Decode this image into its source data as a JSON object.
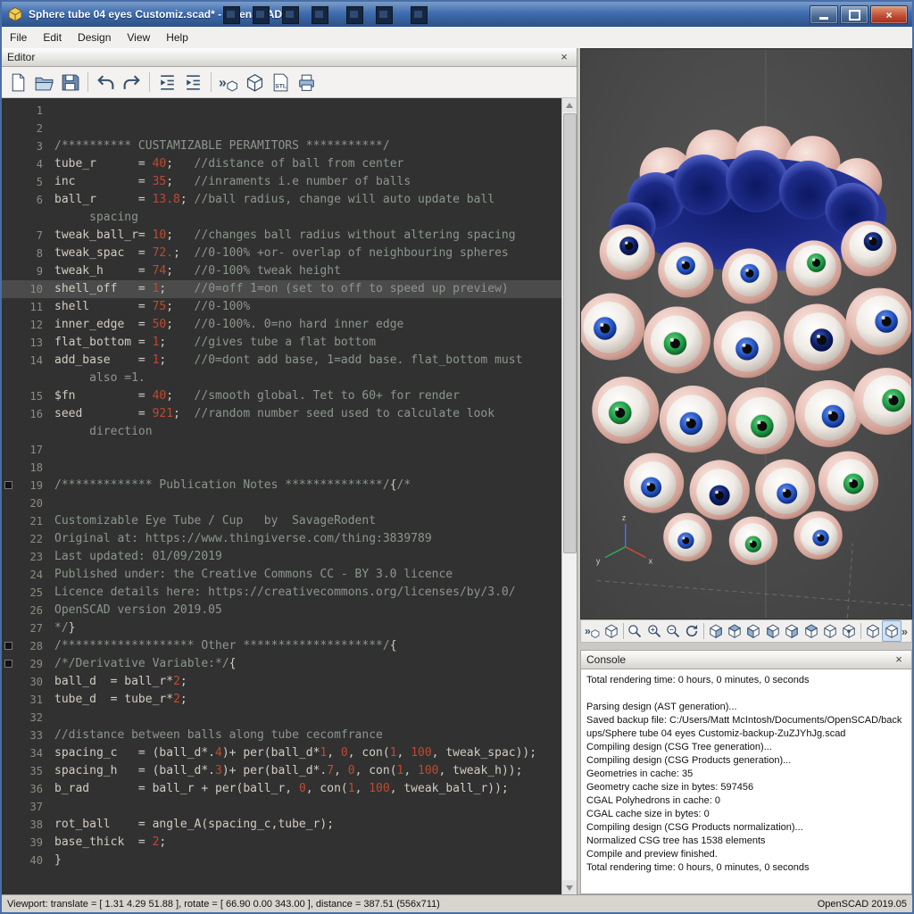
{
  "window": {
    "title": "Sphere tube 04 eyes Customiz.scad* - OpenSCAD"
  },
  "menu": {
    "items": [
      "File",
      "Edit",
      "Design",
      "View",
      "Help"
    ]
  },
  "editor": {
    "panel_title": "Editor",
    "toolbar_icons": [
      "new-file",
      "open",
      "save",
      "undo",
      "redo",
      "unindent",
      "indent",
      "preview",
      "render",
      "export-stl",
      "send-to-printer"
    ],
    "lines": [
      {
        "n": 1,
        "seg": []
      },
      {
        "n": 2,
        "seg": []
      },
      {
        "n": 3,
        "seg": [
          [
            "c",
            "/********** CUSTAMIZABLE PERAMITORS ***********/"
          ]
        ]
      },
      {
        "n": 4,
        "seg": [
          [
            "p",
            "tube_r      = "
          ],
          [
            "v",
            "40"
          ],
          [
            "p",
            ";"
          ],
          [
            "c",
            "   //distance of ball from center"
          ]
        ]
      },
      {
        "n": 5,
        "seg": [
          [
            "p",
            "inc         = "
          ],
          [
            "v",
            "35"
          ],
          [
            "p",
            ";"
          ],
          [
            "c",
            "   //inraments i.e number of balls"
          ]
        ]
      },
      {
        "n": 6,
        "seg": [
          [
            "p",
            "ball_r      = "
          ],
          [
            "v",
            "13.8"
          ],
          [
            "p",
            ";"
          ],
          [
            "c",
            " //ball radius, change will auto update ball\n     spacing"
          ]
        ]
      },
      {
        "n": 7,
        "seg": [
          [
            "p",
            "tweak_ball_r= "
          ],
          [
            "v",
            "10"
          ],
          [
            "p",
            ";"
          ],
          [
            "c",
            "   //changes ball radius without altering spacing"
          ]
        ]
      },
      {
        "n": 8,
        "seg": [
          [
            "p",
            "tweak_spac  = "
          ],
          [
            "v",
            "72."
          ],
          [
            "p",
            ";"
          ],
          [
            "c",
            "  //0-100% +or- overlap of neighbouring spheres"
          ]
        ]
      },
      {
        "n": 9,
        "seg": [
          [
            "p",
            "tweak_h     = "
          ],
          [
            "v",
            "74"
          ],
          [
            "p",
            ";"
          ],
          [
            "c",
            "   //0-100% tweak height"
          ]
        ]
      },
      {
        "n": 10,
        "active": true,
        "seg": [
          [
            "p",
            "shell_off   = "
          ],
          [
            "v",
            "1"
          ],
          [
            "p",
            ";"
          ],
          [
            "c",
            "    //0=off 1=on (set to off to speed up preview)"
          ]
        ]
      },
      {
        "n": 11,
        "seg": [
          [
            "p",
            "shell       = "
          ],
          [
            "v",
            "75"
          ],
          [
            "p",
            ";"
          ],
          [
            "c",
            "   //0-100%"
          ]
        ]
      },
      {
        "n": 12,
        "seg": [
          [
            "p",
            "inner_edge  = "
          ],
          [
            "v",
            "50"
          ],
          [
            "p",
            ";"
          ],
          [
            "c",
            "   //0-100%. 0=no hard inner edge"
          ]
        ]
      },
      {
        "n": 13,
        "seg": [
          [
            "p",
            "flat_bottom = "
          ],
          [
            "v",
            "1"
          ],
          [
            "p",
            ";"
          ],
          [
            "c",
            "    //gives tube a flat bottom"
          ]
        ]
      },
      {
        "n": 14,
        "seg": [
          [
            "p",
            "add_base    = "
          ],
          [
            "v",
            "1"
          ],
          [
            "p",
            ";"
          ],
          [
            "c",
            "    //0=dont add base, 1=add base. flat_bottom must\n     also =1."
          ]
        ]
      },
      {
        "n": 15,
        "seg": [
          [
            "p",
            "$fn         = "
          ],
          [
            "v",
            "40"
          ],
          [
            "p",
            ";"
          ],
          [
            "c",
            "   //smooth global. Tet to 60+ for render"
          ]
        ]
      },
      {
        "n": 16,
        "seg": [
          [
            "p",
            "seed        = "
          ],
          [
            "v",
            "921"
          ],
          [
            "p",
            ";"
          ],
          [
            "c",
            "  //random number seed used to calculate look\n     direction"
          ]
        ]
      },
      {
        "n": 17,
        "seg": []
      },
      {
        "n": 18,
        "seg": []
      },
      {
        "n": 19,
        "fold": true,
        "seg": [
          [
            "c",
            "/************* Publication Notes **************/"
          ],
          [
            "p",
            "{"
          ],
          [
            "c",
            "/*"
          ]
        ]
      },
      {
        "n": 20,
        "seg": []
      },
      {
        "n": 21,
        "seg": [
          [
            "c",
            "Customizable Eye Tube / Cup   by  SavageRodent"
          ]
        ]
      },
      {
        "n": 22,
        "seg": [
          [
            "c",
            "Original at: https://www.thingiverse.com/thing:3839789"
          ]
        ]
      },
      {
        "n": 23,
        "seg": [
          [
            "c",
            "Last updated: 01/09/2019"
          ]
        ]
      },
      {
        "n": 24,
        "seg": [
          [
            "c",
            "Published under: the Creative Commons CC - BY 3.0 licence"
          ]
        ]
      },
      {
        "n": 25,
        "seg": [
          [
            "c",
            "Licence details here: https://creativecommons.org/licenses/by/3.0/"
          ]
        ]
      },
      {
        "n": 26,
        "seg": [
          [
            "c",
            "OpenSCAD version 2019.05"
          ]
        ]
      },
      {
        "n": 27,
        "seg": [
          [
            "c",
            "*/"
          ],
          [
            "p",
            "}"
          ]
        ]
      },
      {
        "n": 28,
        "fold": true,
        "seg": [
          [
            "c",
            "/******************* Other ********************/"
          ],
          [
            "p",
            "{"
          ]
        ]
      },
      {
        "n": 29,
        "fold": true,
        "seg": [
          [
            "c",
            "/*/Derivative Variable:*/"
          ],
          [
            "p",
            "{"
          ]
        ]
      },
      {
        "n": 30,
        "seg": [
          [
            "p",
            "ball_d  = ball_r*"
          ],
          [
            "v",
            "2"
          ],
          [
            "p",
            ";"
          ]
        ]
      },
      {
        "n": 31,
        "seg": [
          [
            "p",
            "tube_d  = tube_r*"
          ],
          [
            "v",
            "2"
          ],
          [
            "p",
            ";"
          ]
        ]
      },
      {
        "n": 32,
        "seg": []
      },
      {
        "n": 33,
        "seg": [
          [
            "c",
            "//distance between balls along tube cecomfrance"
          ]
        ]
      },
      {
        "n": 34,
        "seg": [
          [
            "p",
            "spacing_c   = (ball_d*."
          ],
          [
            "v",
            "4"
          ],
          [
            "p",
            ")+ per(ball_d*"
          ],
          [
            "v",
            "1"
          ],
          [
            "p",
            ", "
          ],
          [
            "v",
            "0"
          ],
          [
            "p",
            ", con("
          ],
          [
            "v",
            "1"
          ],
          [
            "p",
            ", "
          ],
          [
            "v",
            "100"
          ],
          [
            "p",
            ", tweak_spac));"
          ]
        ]
      },
      {
        "n": 35,
        "seg": [
          [
            "p",
            "spacing_h   = (ball_d*."
          ],
          [
            "v",
            "3"
          ],
          [
            "p",
            ")+ per(ball_d*."
          ],
          [
            "v",
            "7"
          ],
          [
            "p",
            ", "
          ],
          [
            "v",
            "0"
          ],
          [
            "p",
            ", con("
          ],
          [
            "v",
            "1"
          ],
          [
            "p",
            ", "
          ],
          [
            "v",
            "100"
          ],
          [
            "p",
            ", tweak_h));"
          ]
        ]
      },
      {
        "n": 36,
        "seg": [
          [
            "p",
            "b_rad       = ball_r + per(ball_r, "
          ],
          [
            "v",
            "0"
          ],
          [
            "p",
            ", con("
          ],
          [
            "v",
            "1"
          ],
          [
            "p",
            ", "
          ],
          [
            "v",
            "100"
          ],
          [
            "p",
            ", tweak_ball_r));"
          ]
        ]
      },
      {
        "n": 37,
        "seg": []
      },
      {
        "n": 38,
        "seg": [
          [
            "p",
            "rot_ball    = angle_A(spacing_c,tube_r);"
          ]
        ]
      },
      {
        "n": 39,
        "seg": [
          [
            "p",
            "base_thick  = "
          ],
          [
            "v",
            "2"
          ],
          [
            "p",
            ";"
          ]
        ]
      },
      {
        "n": 40,
        "seg": [
          [
            "p",
            "}"
          ]
        ]
      }
    ]
  },
  "viewport": {
    "toolbar_icons": [
      "preview",
      "render",
      "view-all",
      "zoom-in",
      "zoom-out",
      "reset-view",
      "view-right",
      "view-top",
      "view-bottom",
      "view-left",
      "view-front",
      "view-back",
      "view-diagonal",
      "view-center",
      "perspective",
      "orthogonal"
    ],
    "overflow_label": "»",
    "axis_labels": {
      "x": "x",
      "y": "y",
      "z": "z"
    }
  },
  "console": {
    "panel_title": "Console",
    "lines": [
      "Total rendering time: 0 hours, 0 minutes, 0 seconds",
      "",
      "Parsing design (AST generation)...",
      "Saved backup file: C:/Users/Matt McIntosh/Documents/OpenSCAD/backups/Sphere tube 04 eyes Customiz-backup-ZuZJYhJg.scad",
      "Compiling design (CSG Tree generation)...",
      "Compiling design (CSG Products generation)...",
      "Geometries in cache: 35",
      "Geometry cache size in bytes: 597456",
      "CGAL Polyhedrons in cache: 0",
      "CGAL cache size in bytes: 0",
      "Compiling design (CSG Products normalization)...",
      "Normalized CSG tree has 1538 elements",
      "Compile and preview finished.",
      "Total rendering time: 0 hours, 0 minutes, 0 seconds"
    ]
  },
  "statusbar": {
    "left": "Viewport: translate = [ 1.31 4.29 51.88 ], rotate = [ 66.90 0.00 343.00 ], distance = 387.51 (556x711)",
    "right": "OpenSCAD 2019.05"
  },
  "colors": {
    "iris_blue": "#2356c8",
    "iris_navy": "#0c1e66",
    "iris_green": "#1f9e46",
    "socket_pink": "#e9c4bb",
    "interior_blue": "#1c2a86",
    "titlebar": "#3f6db0"
  }
}
